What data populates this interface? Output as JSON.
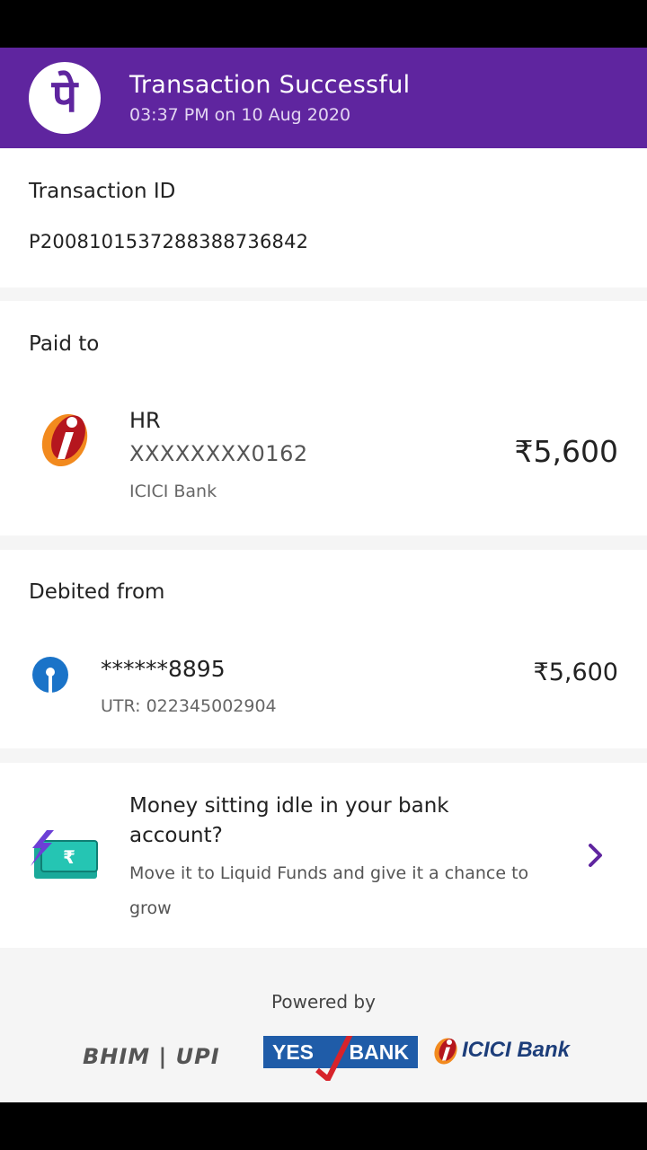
{
  "header": {
    "logo_glyph": "पे",
    "title": "Transaction Successful",
    "subtitle": "03:37 PM on 10 Aug 2020",
    "brand_color": "#5f259f"
  },
  "transaction": {
    "label": "Transaction ID",
    "id": "P2008101537288388736842"
  },
  "paid_to": {
    "label": "Paid to",
    "icon": "icici-bank-logo-icon",
    "name": "HR",
    "account": "XXXXXXXX0162",
    "bank": "ICICI Bank",
    "amount": "₹5,600"
  },
  "debited_from": {
    "label": "Debited from",
    "icon": "sbi-logo-icon",
    "account": "******8895",
    "utr": "UTR: 022345002904",
    "amount": "₹5,600"
  },
  "promo": {
    "icon": "money-bolt-icon",
    "title": "Money sitting idle in your bank account?",
    "description": "Move it to Liquid Funds and give it a chance to grow",
    "chevron": "chevron-right-icon"
  },
  "footer": {
    "powered_by": "Powered by",
    "logos": {
      "bhim_upi": "BHIM | UPI",
      "yes_left": "YES",
      "yes_right": "BANK",
      "icici": "ICICI Bank"
    }
  }
}
